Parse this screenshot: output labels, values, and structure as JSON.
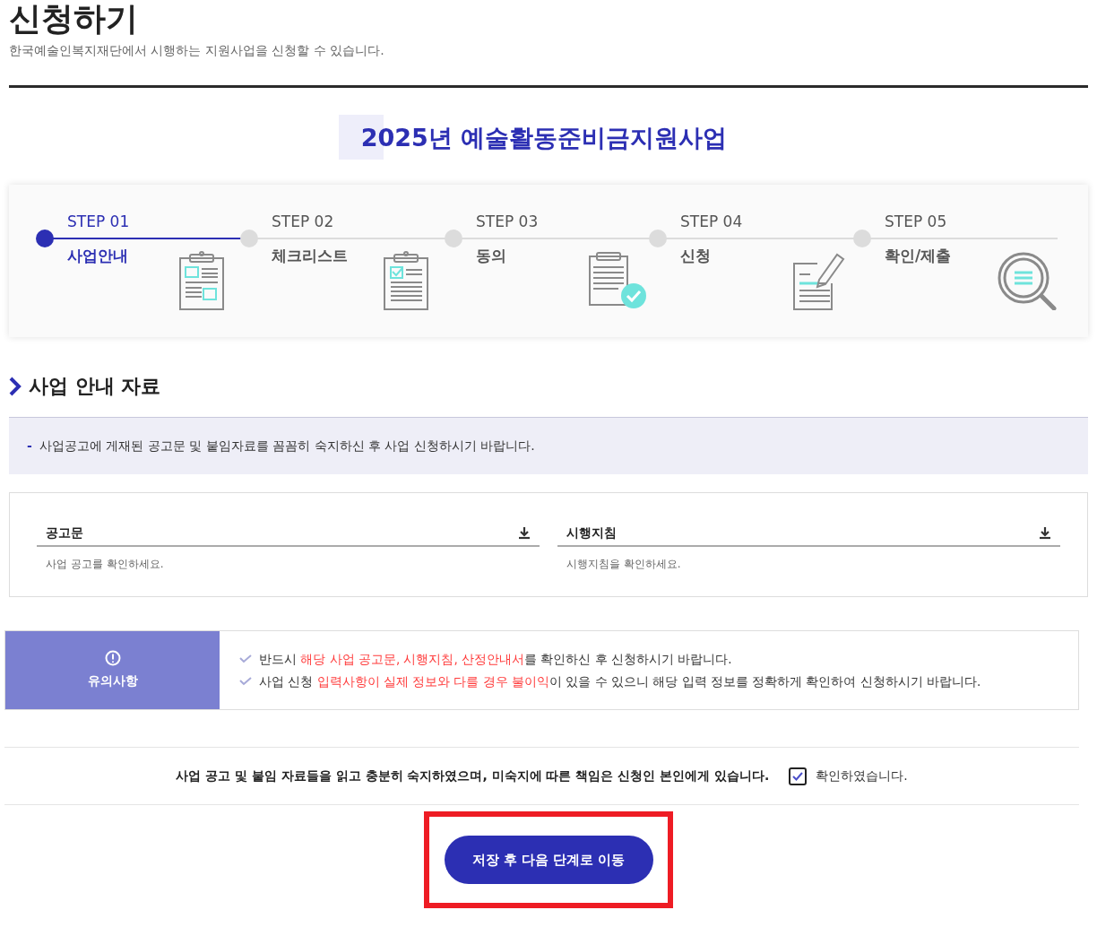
{
  "page": {
    "title": "신청하기",
    "subtitle": "한국예술인복지재단에서 시행하는 지원사업을 신청할 수 있습니다."
  },
  "program_title": "2025년 예술활동준비금지원사업",
  "steps": [
    {
      "label": "STEP 01",
      "name": "사업안내",
      "selected": true,
      "kind": "form"
    },
    {
      "label": "STEP 02",
      "name": "체크리스트",
      "selected": false,
      "kind": "checklist"
    },
    {
      "label": "STEP 03",
      "name": "동의",
      "selected": false,
      "kind": "approved"
    },
    {
      "label": "STEP 04",
      "name": "신청",
      "selected": false,
      "kind": "write"
    },
    {
      "label": "STEP 05",
      "name": "확인/제출",
      "selected": false,
      "kind": "search"
    }
  ],
  "section_title": "사업 안내 자료",
  "notice": {
    "bullet": "-",
    "text": "사업공고에 게재된 공고문 및 붙임자료를 꼼꼼히 숙지하신 후 사업 신청하시기 바랍니다."
  },
  "downloads": [
    {
      "title": "공고문",
      "description": "사업 공고를 확인하세요."
    },
    {
      "title": "시행지침",
      "description": "시행지침을 확인하세요."
    }
  ],
  "caution": {
    "label": "유의사항",
    "items": [
      [
        {
          "text": "반드시 ",
          "emphasis": false
        },
        {
          "text": "해당 사업 공고문, 시행지침, 산정안내서",
          "emphasis": true
        },
        {
          "text": "를 확인하신 후 신청하시기 바랍니다.",
          "emphasis": false
        }
      ],
      [
        {
          "text": "사업 신청 ",
          "emphasis": false
        },
        {
          "text": "입력사항이 실제 정보와 다를 경우 불이익",
          "emphasis": true
        },
        {
          "text": "이 있을 수 있으니 해당 입력 정보를 정확하게 확인하여 신청하시기 바랍니다.",
          "emphasis": false
        }
      ]
    ]
  },
  "agreement": {
    "text": "사업 공고 및 붙임 자료들을 읽고 충분히 숙지하였으며, 미숙지에 따른 책임은 신청인 본인에게 있습니다.",
    "checkbox_label": "확인하였습니다.",
    "checked": true
  },
  "submit": {
    "label": "저장 후 다음 단계로 이동",
    "highlighted": true
  }
}
